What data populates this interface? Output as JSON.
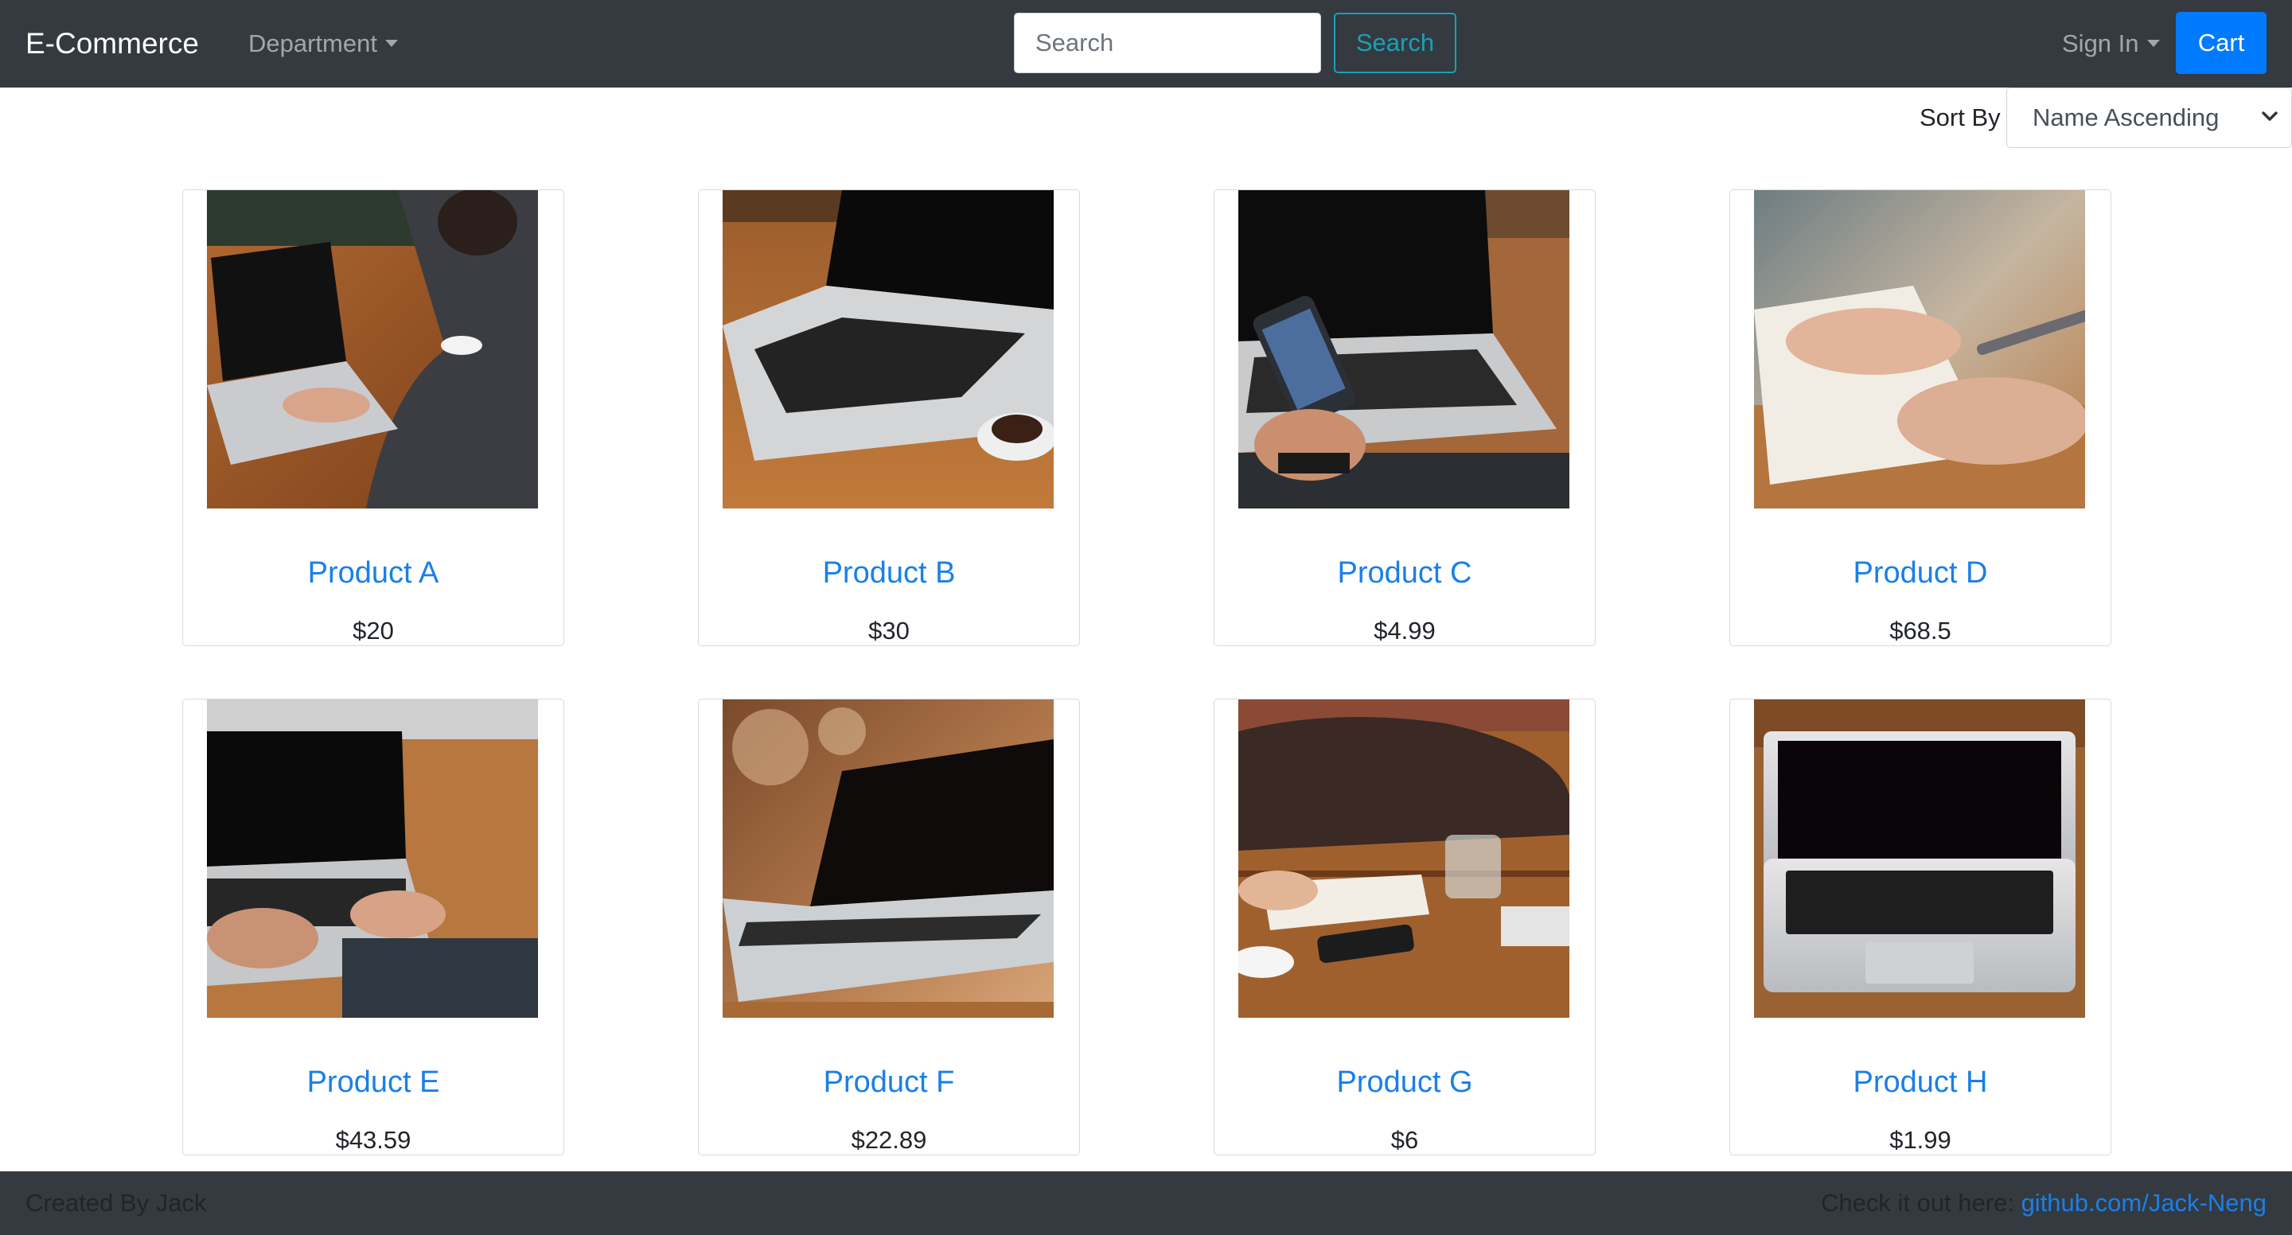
{
  "navbar": {
    "brand": "E-Commerce",
    "department_label": "Department",
    "search_placeholder": "Search",
    "search_button": "Search",
    "signin_label": "Sign In",
    "cart_label": "Cart"
  },
  "sort": {
    "label": "Sort By",
    "selected": "Name Ascending"
  },
  "products": [
    {
      "name": "Product A",
      "price": "$20"
    },
    {
      "name": "Product B",
      "price": "$30"
    },
    {
      "name": "Product C",
      "price": "$4.99"
    },
    {
      "name": "Product D",
      "price": "$68.5"
    },
    {
      "name": "Product E",
      "price": "$43.59"
    },
    {
      "name": "Product F",
      "price": "$22.89"
    },
    {
      "name": "Product G",
      "price": "$6"
    },
    {
      "name": "Product H",
      "price": "$1.99"
    }
  ],
  "footer": {
    "created_by": "Created By Jack",
    "check_text": "Check it out here: ",
    "link_text": "github.com/Jack-Neng"
  },
  "colors": {
    "navbar_bg": "#343a40",
    "link_blue": "#1a7fe8",
    "primary": "#007bff",
    "info": "#17a2b8"
  }
}
